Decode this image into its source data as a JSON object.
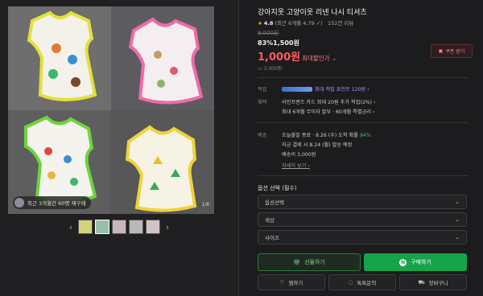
{
  "gallery": {
    "review_badge": "최근 3개월간 60명 재구매",
    "review_badge_strong": "3개월간 60명",
    "counter": "1/8",
    "prev_arrow": "‹",
    "next_arrow": "›"
  },
  "product": {
    "title": "강아지옷 고양이옷 리넨 나시 티셔츠",
    "rating_star": "★",
    "rating_score": "4.8",
    "rating_note": "(최근 6개월 4.79 ✓)",
    "review_count": "152건 리뷰",
    "original_price": "9,000원",
    "discount_rate": "83%",
    "discount_price": "1,500원",
    "final_price": "1,000원",
    "final_label": "최대할인가 ⌄",
    "coupon_label": "쿠폰 받기",
    "coupon_icon": "coupon-icon",
    "shipping": "3,000원"
  },
  "benefits": {
    "points_label": "적립",
    "points_text": "최대 적립 포인트 120원 ›",
    "card_label": "혜택",
    "card_line1": "라인프렌즈 카드 최대 20원 추가 적립(2%) ›",
    "card_line2": "최대 6개월 무이자 할부 · 60개월 특별금리 ›"
  },
  "delivery": {
    "label": "배송",
    "line1_prefix": "오늘출발 종료 · 8.26 (수) 도착 확률 ",
    "line1_pct": "94%",
    "line2": "지금 결제 시 8.24 (월) 발송 예정",
    "line3": "배송비 3,000원",
    "more": "자세히 보기 ›"
  },
  "options": {
    "title": "옵션 선택 (필수)",
    "selects": [
      {
        "label": "옵션선택"
      },
      {
        "label": "색상"
      },
      {
        "label": "사이즈"
      }
    ],
    "chevron": "⌄"
  },
  "actions": {
    "gift": "선물하기",
    "buy": "구매하기",
    "wish": "찜하기",
    "talk": "톡톡문의",
    "cart": "장바구니"
  },
  "colors": {
    "price_red": "#ff5a5f",
    "buy_green": "#17a34a",
    "points_purple": "#b48cff"
  }
}
